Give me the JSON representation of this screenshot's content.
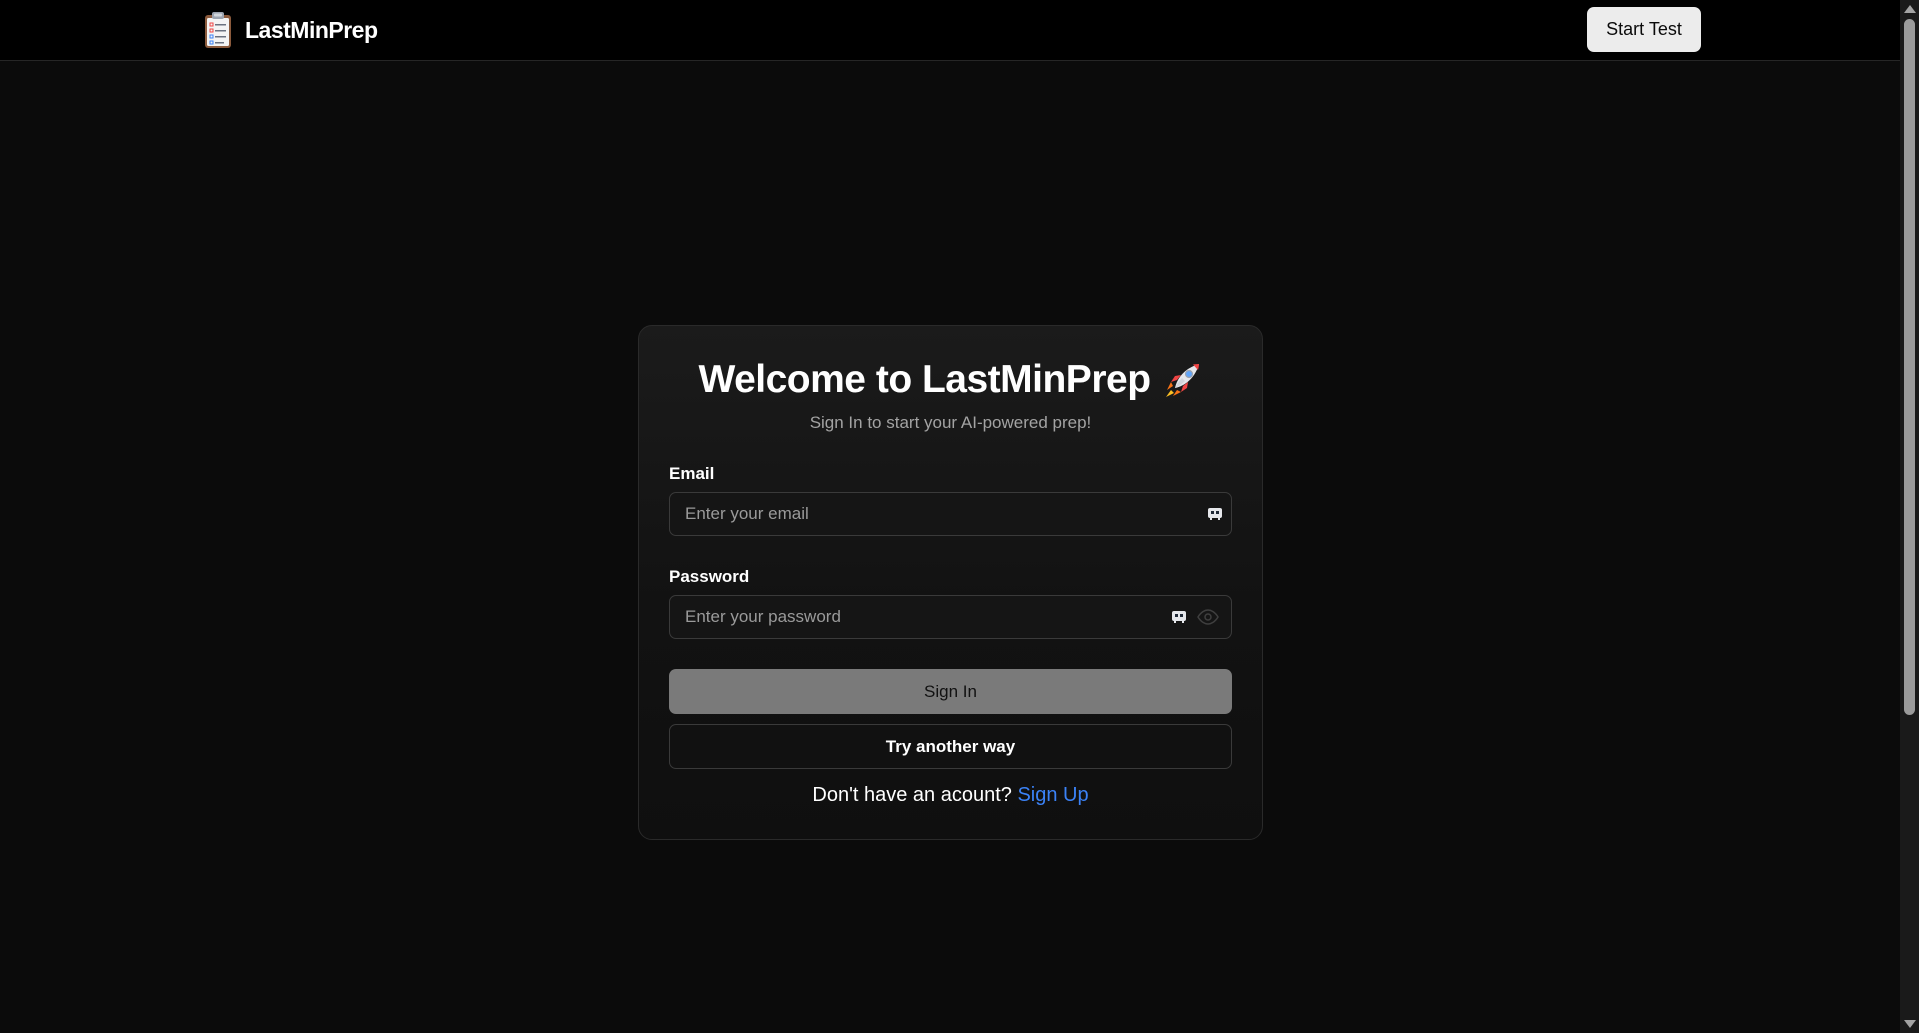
{
  "header": {
    "brand_name": "LastMinPrep",
    "brand_icon": "clipboard-icon",
    "start_test_label": "Start Test"
  },
  "login": {
    "title": "Welcome to LastMinPrep",
    "title_icon": "rocket-icon",
    "subtitle": "Sign In to start your AI-powered prep!",
    "email_label": "Email",
    "email_placeholder": "Enter your email",
    "email_value": "",
    "password_label": "Password",
    "password_placeholder": "Enter your password",
    "password_value": "",
    "sign_in_label": "Sign In",
    "try_another_label": "Try another way",
    "no_account_text": "Don't have an acount?",
    "sign_up_label": "Sign Up"
  },
  "colors": {
    "page_background": "#0b0b0b",
    "header_background": "#000000",
    "link": "#3b82f6",
    "sign_in_button": "#7a7a7a",
    "start_test_button": "#ececec"
  }
}
